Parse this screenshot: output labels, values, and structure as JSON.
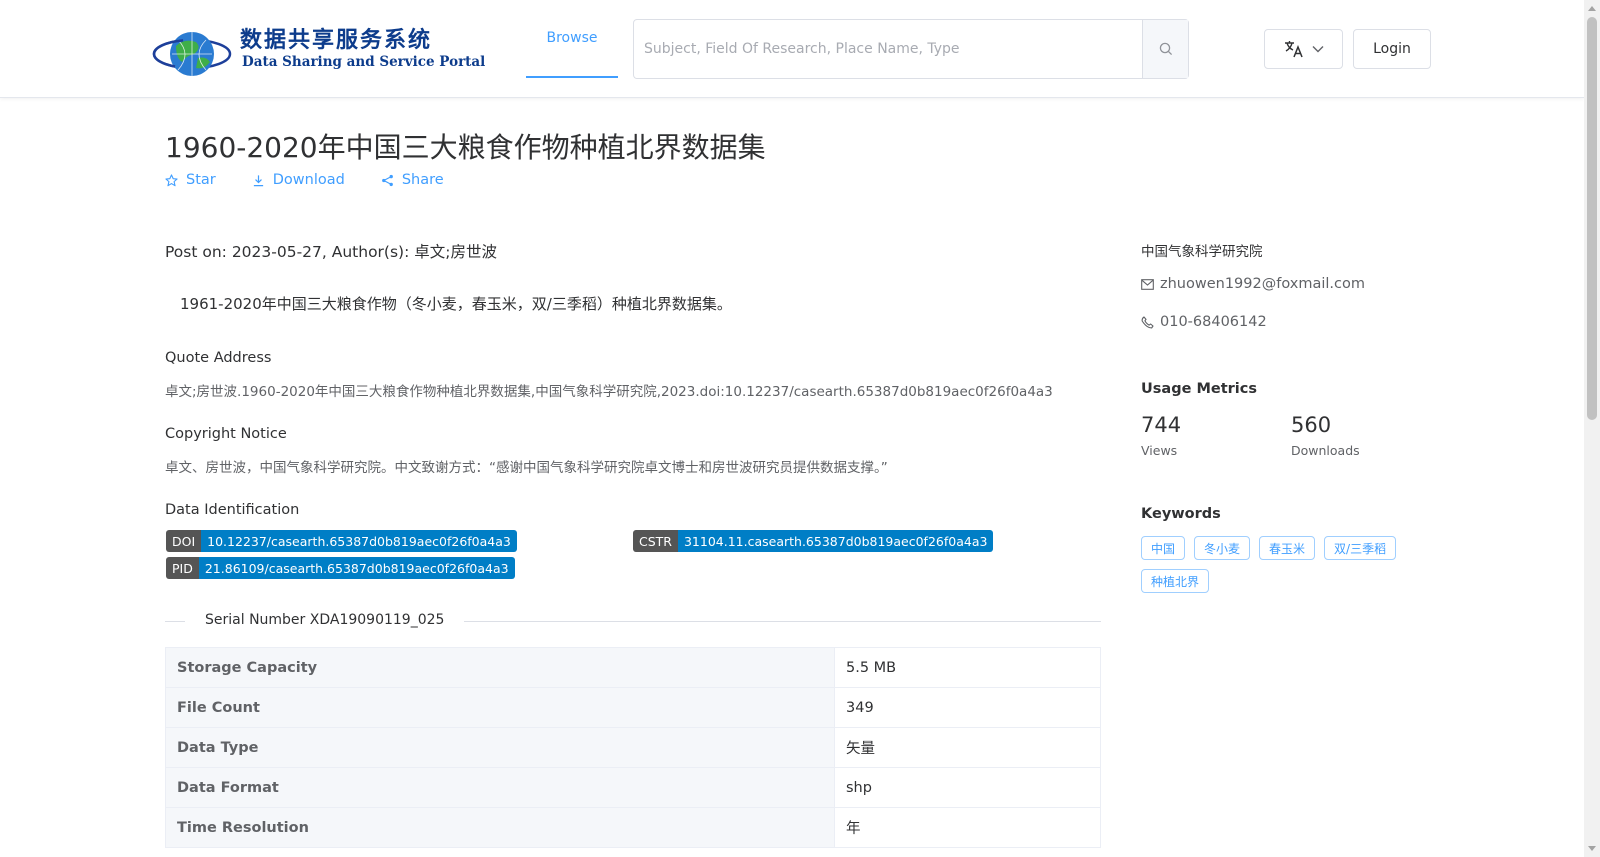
{
  "header": {
    "logo_cn": "数据共享服务系统",
    "logo_en": "Data Sharing and Service Portal",
    "nav_browse": "Browse",
    "search_placeholder": "Subject, Field Of Research, Place Name, Type",
    "login_label": "Login",
    "icons": {
      "search": "search-icon",
      "language": "translate-icon",
      "dropdown": "chevron-down-icon"
    }
  },
  "dataset": {
    "title": "1960-2020年中国三大粮食作物种植北界数据集",
    "actions": {
      "star": "Star",
      "download": "Download",
      "share": "Share"
    },
    "post_line": "Post on: 2023-05-27, Author(s): 卓文;房世波",
    "summary": "1961-2020年中国三大粮食作物（冬小麦，春玉米，双/三季稻）种植北界数据集。",
    "quote_label": "Quote Address",
    "quote_text": "卓文;房世波.1960-2020年中国三大粮食作物种植北界数据集,中国气象科学研究院,2023.doi:10.12237/casearth.65387d0b819aec0f26f0a4a3",
    "copyright_label": "Copyright Notice",
    "copyright_text": "卓文、房世波，中国气象科学研究院。中文致谢方式：“感谢中国气象科学研究院卓文博士和房世波研究员提供数据支撑。”",
    "identification_label": "Data Identification",
    "badges": {
      "doi_key": "DOI",
      "doi_value": "10.12237/casearth.65387d0b819aec0f26f0a4a3",
      "cstr_key": "CSTR",
      "cstr_value": "31104.11.casearth.65387d0b819aec0f26f0a4a3",
      "pid_key": "PID",
      "pid_value": "21.86109/casearth.65387d0b819aec0f26f0a4a3"
    },
    "serial_number": "Serial Number XDA19090119_025",
    "table": [
      {
        "key": "Storage Capacity",
        "value": "5.5 MB"
      },
      {
        "key": "File Count",
        "value": "349"
      },
      {
        "key": "Data Type",
        "value": "矢量"
      },
      {
        "key": "Data Format",
        "value": "shp"
      },
      {
        "key": "Time Resolution",
        "value": "年"
      }
    ]
  },
  "sidebar": {
    "organization": "中国气象科学研究院",
    "email": "zhuowen1992@foxmail.com",
    "phone": "010-68406142",
    "metrics_heading": "Usage Metrics",
    "views_count": "744",
    "views_label": "Views",
    "downloads_count": "560",
    "downloads_label": "Downloads",
    "keywords_heading": "Keywords",
    "keywords": [
      "中国",
      "冬小麦",
      "春玉米",
      "双/三季稻",
      "种植北界"
    ]
  },
  "colors": {
    "accent": "#409eff",
    "badge_key": "#555555",
    "badge_value": "#007ec6",
    "logo_text": "#0d3c8c"
  }
}
